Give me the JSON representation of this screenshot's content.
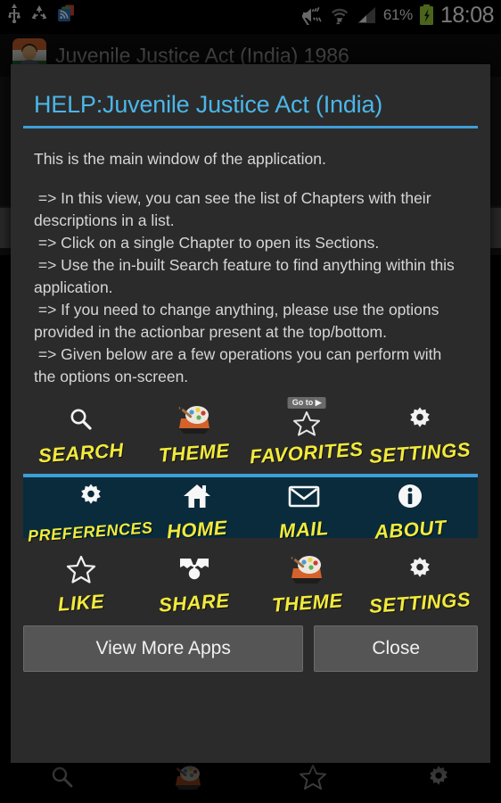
{
  "statusbar": {
    "left_icons": [
      "usb-icon",
      "sync-icon",
      "rss-icon"
    ],
    "right_icons": [
      "mute-icon",
      "wifi-icon",
      "signal-icon",
      "battery-charging-icon"
    ],
    "battery_percent": "61%",
    "clock": "18:08"
  },
  "background_app": {
    "title": "Juvenile Justice Act (India) 1986",
    "bottom_bar_items": [
      {
        "icon": "search-icon",
        "name": "search"
      },
      {
        "icon": "palette-icon",
        "name": "theme"
      },
      {
        "icon": "star-icon",
        "name": "favorites"
      },
      {
        "icon": "gear-icon",
        "name": "settings"
      }
    ]
  },
  "dialog": {
    "title": "HELP:Juvenile Justice Act (India)",
    "intro": "This is the main window of the application.",
    "bullets": [
      " => In this view, you can see the list of Chapters with their descriptions in a list.",
      " => Click on a single Chapter to open its Sections.",
      " => Use the in-built Search feature to find anything within this application.",
      " => If you need to change anything, please use the options provided in the actionbar present at the top/bottom.",
      " => Given below are a few operations you can perform with the options on-screen."
    ],
    "row1": [
      {
        "label": "SEARCH",
        "icon": "search-icon",
        "badge": ""
      },
      {
        "label": "THEME",
        "icon": "palette-icon",
        "badge": ""
      },
      {
        "label": "FAVORITES",
        "icon": "star-icon",
        "badge": "Go to ▶"
      },
      {
        "label": "SETTINGS",
        "icon": "gear-icon",
        "badge": ""
      }
    ],
    "row2": [
      {
        "label": "PREFERENCES",
        "icon": "gear-icon"
      },
      {
        "label": "HOME",
        "icon": "home-icon"
      },
      {
        "label": "MAIL",
        "icon": "mail-icon"
      },
      {
        "label": "ABOUT",
        "icon": "info-icon"
      }
    ],
    "row3": [
      {
        "label": "LIKE",
        "icon": "star-icon"
      },
      {
        "label": "SHARE",
        "icon": "share-icon"
      },
      {
        "label": "THEME",
        "icon": "palette-icon"
      },
      {
        "label": "SETTINGS",
        "icon": "gear-icon"
      }
    ],
    "buttons": {
      "more_apps": "View More Apps",
      "close": "Close"
    },
    "colors": {
      "title_accent": "#4bb6e8",
      "rule": "#3d9ed6",
      "caption": "#f2ea3c",
      "highlight_panel": "#092b3c",
      "dialog_bg": "#2b2b2b"
    }
  }
}
